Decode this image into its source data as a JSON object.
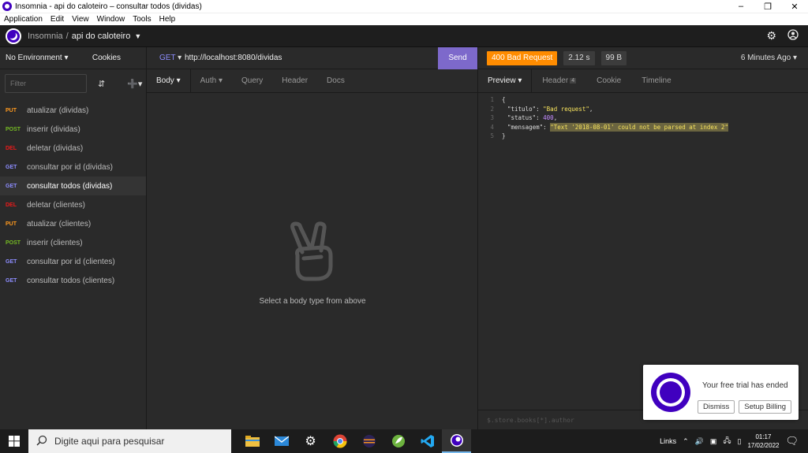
{
  "window": {
    "title": "Insomnia - api do caloteiro – consultar todos (dividas)"
  },
  "menu": [
    "Application",
    "Edit",
    "View",
    "Window",
    "Tools",
    "Help"
  ],
  "header": {
    "app_name": "Insomnia",
    "separator": "/",
    "workspace": "api do caloteiro"
  },
  "sidebar": {
    "environment": "No Environment",
    "cookies": "Cookies",
    "filter_placeholder": "Filter",
    "requests": [
      {
        "method": "PUT",
        "name": "atualizar (dividas)"
      },
      {
        "method": "POST",
        "name": "inserir (dividas)"
      },
      {
        "method": "DEL",
        "name": "deletar (dividas)"
      },
      {
        "method": "GET",
        "name": "consultar por id (dividas)"
      },
      {
        "method": "GET",
        "name": "consultar todos (dividas)"
      },
      {
        "method": "DEL",
        "name": "deletar (clientes)"
      },
      {
        "method": "PUT",
        "name": "atualizar (clientes)"
      },
      {
        "method": "POST",
        "name": "inserir (clientes)"
      },
      {
        "method": "GET",
        "name": "consultar por id (clientes)"
      },
      {
        "method": "GET",
        "name": "consultar todos (clientes)"
      }
    ]
  },
  "request": {
    "method": "GET",
    "url": "http://localhost:8080/dividas",
    "send_label": "Send",
    "tabs": [
      "Body",
      "Auth",
      "Query",
      "Header",
      "Docs"
    ],
    "empty_message": "Select a body type from above"
  },
  "response": {
    "status": "400 Bad Request",
    "time": "2.12 s",
    "size": "99 B",
    "time_ago": "6 Minutes Ago",
    "tabs": {
      "preview": "Preview",
      "header": "Header",
      "header_count": "4",
      "cookie": "Cookie",
      "timeline": "Timeline"
    },
    "body": {
      "open": "{",
      "titulo_key": "\"titulo\"",
      "titulo_value": "\"Bad request\"",
      "status_key": "\"status\"",
      "status_value": "400",
      "mensagem_key": "\"mensagem\"",
      "mensagem_value": "\"Text '2018-08-01' could not be parsed at index 2\"",
      "close": "}",
      "line_numbers": [
        "1",
        "2",
        "3",
        "4",
        "5"
      ]
    },
    "filter_placeholder": "$.store.books[*].author"
  },
  "toast": {
    "message": "Your free trial has ended",
    "dismiss": "Dismiss",
    "setup": "Setup Billing"
  },
  "taskbar": {
    "search_placeholder": "Digite aqui para pesquisar",
    "links": "Links",
    "time": "01:17",
    "date": "17/02/2022"
  },
  "colors": {
    "brand": "#4000bf",
    "send": "#7d69cb",
    "status_error": "#ff8c00"
  }
}
